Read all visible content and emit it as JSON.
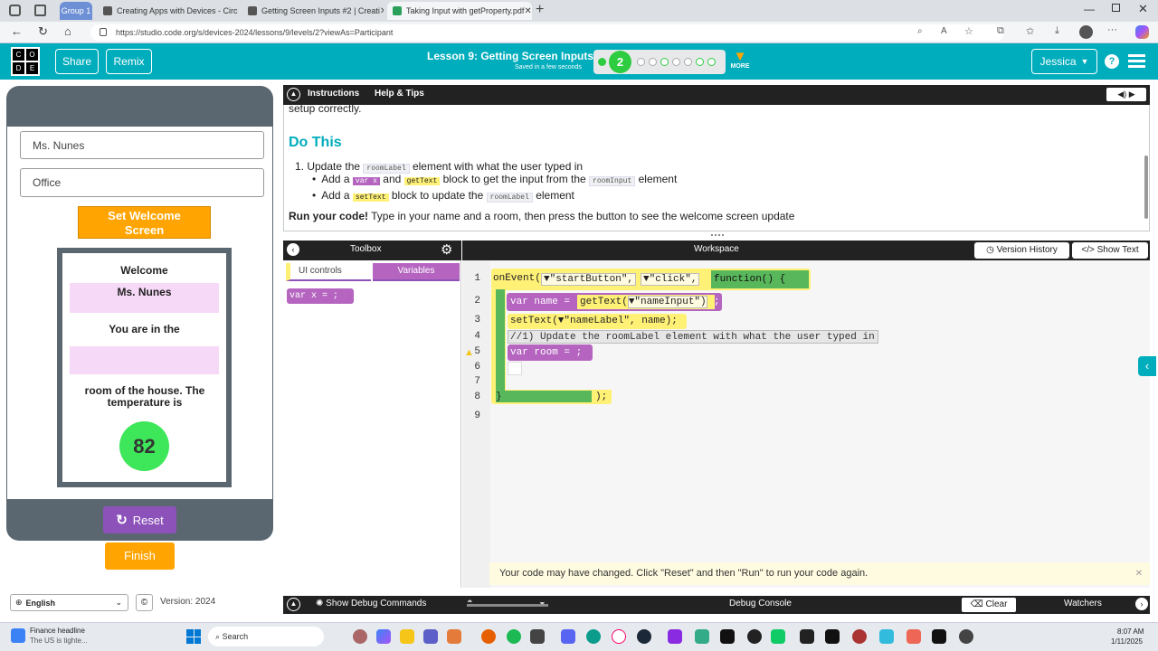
{
  "browser": {
    "tabs": [
      {
        "label": "Group 1"
      },
      {
        "label": "Creating Apps with Devices - Circ"
      },
      {
        "label": "Getting Screen Inputs #2 | Creati"
      },
      {
        "label": "Taking Input with getProperty.pdf"
      }
    ],
    "url": "https://studio.code.org/s/devices-2024/lessons/9/levels/2?viewAs=Participant"
  },
  "header": {
    "logo_letters": [
      "C",
      "O",
      "D",
      "E"
    ],
    "share_label": "Share",
    "remix_label": "Remix",
    "lesson_title": "Lesson 9: Getting Screen Inputs",
    "saved_text": "Saved in a few seconds",
    "current_level": "2",
    "more_label": "MORE",
    "user_name": "Jessica",
    "help_label": "?"
  },
  "app": {
    "name_value": "Ms. Nunes",
    "room_value": "Office",
    "set_button_label": "Set Welcome Screen",
    "welcome_label": "Welcome",
    "name_label": "Ms. Nunes",
    "you_are_in": "You are in the",
    "room_label": "",
    "room_text": "room of the house. The temperature is",
    "temperature": "82",
    "reset_label": "Reset",
    "finish_label": "Finish",
    "language": "English",
    "version": "Version: 2024"
  },
  "instructions": {
    "tab_instructions": "Instructions",
    "tab_help": "Help & Tips",
    "cut_text": "setup correctly.",
    "heading": "Do This",
    "step1_a": "1. Update the",
    "step1_kw": "roomLabel",
    "step1_b": "element with what the user typed in",
    "sub1_a": "Add a",
    "sub1_blk1": "var x",
    "sub1_and": "and",
    "sub1_blk2": "getText",
    "sub1_b": "block to get the input from the",
    "sub1_kw": "roomInput",
    "sub1_c": "element",
    "sub2_a": "Add a",
    "sub2_blk": "setText",
    "sub2_b": "block to update the",
    "sub2_kw": "roomLabel",
    "sub2_c": "element",
    "run_bold": "Run your code!",
    "run_text": "Type in your name and a room, then press the button to see the welcome screen update"
  },
  "toolbox": {
    "title": "Toolbox",
    "tab_ui": "UI controls",
    "tab_vars": "Variables",
    "block_text": "var x = ;"
  },
  "workspace": {
    "title": "Workspace",
    "version_history": "Version History",
    "show_text": "Show Text",
    "lines": [
      "1",
      "2",
      "3",
      "4",
      "5",
      "6",
      "7",
      "8",
      "9"
    ],
    "code_line1_a": "onEvent(",
    "code_line1_b": "\"startButton\",",
    "code_line1_c": "\"click\",",
    "code_line1_fn": "function() {",
    "code_line2_var": "var name =",
    "code_line2_get": "getText(",
    "code_line2_arg": "\"nameInput\")",
    "code_line3": "setText(▼\"nameLabel\", name);",
    "code_line4": "//1) Update the roomLabel element with what the user typed in",
    "code_line5": "var room = ;",
    "code_line8_a": "}",
    "code_line8_b": ");",
    "warning": "Your code may have changed. Click \"Reset\" and then \"Run\" to run your code again."
  },
  "debug": {
    "show_commands": "Show Debug Commands",
    "console": "Debug Console",
    "clear": "Clear",
    "watchers": "Watchers"
  },
  "taskbar": {
    "news_title": "Finance headline",
    "news_sub": "The US is tighte...",
    "search": "Search",
    "time": "8:07 AM",
    "date": "1/11/2025"
  },
  "colors": {
    "teal": "#00adbc",
    "orange": "#ffa400",
    "purple": "#8c52ba",
    "green": "#59b75b"
  }
}
